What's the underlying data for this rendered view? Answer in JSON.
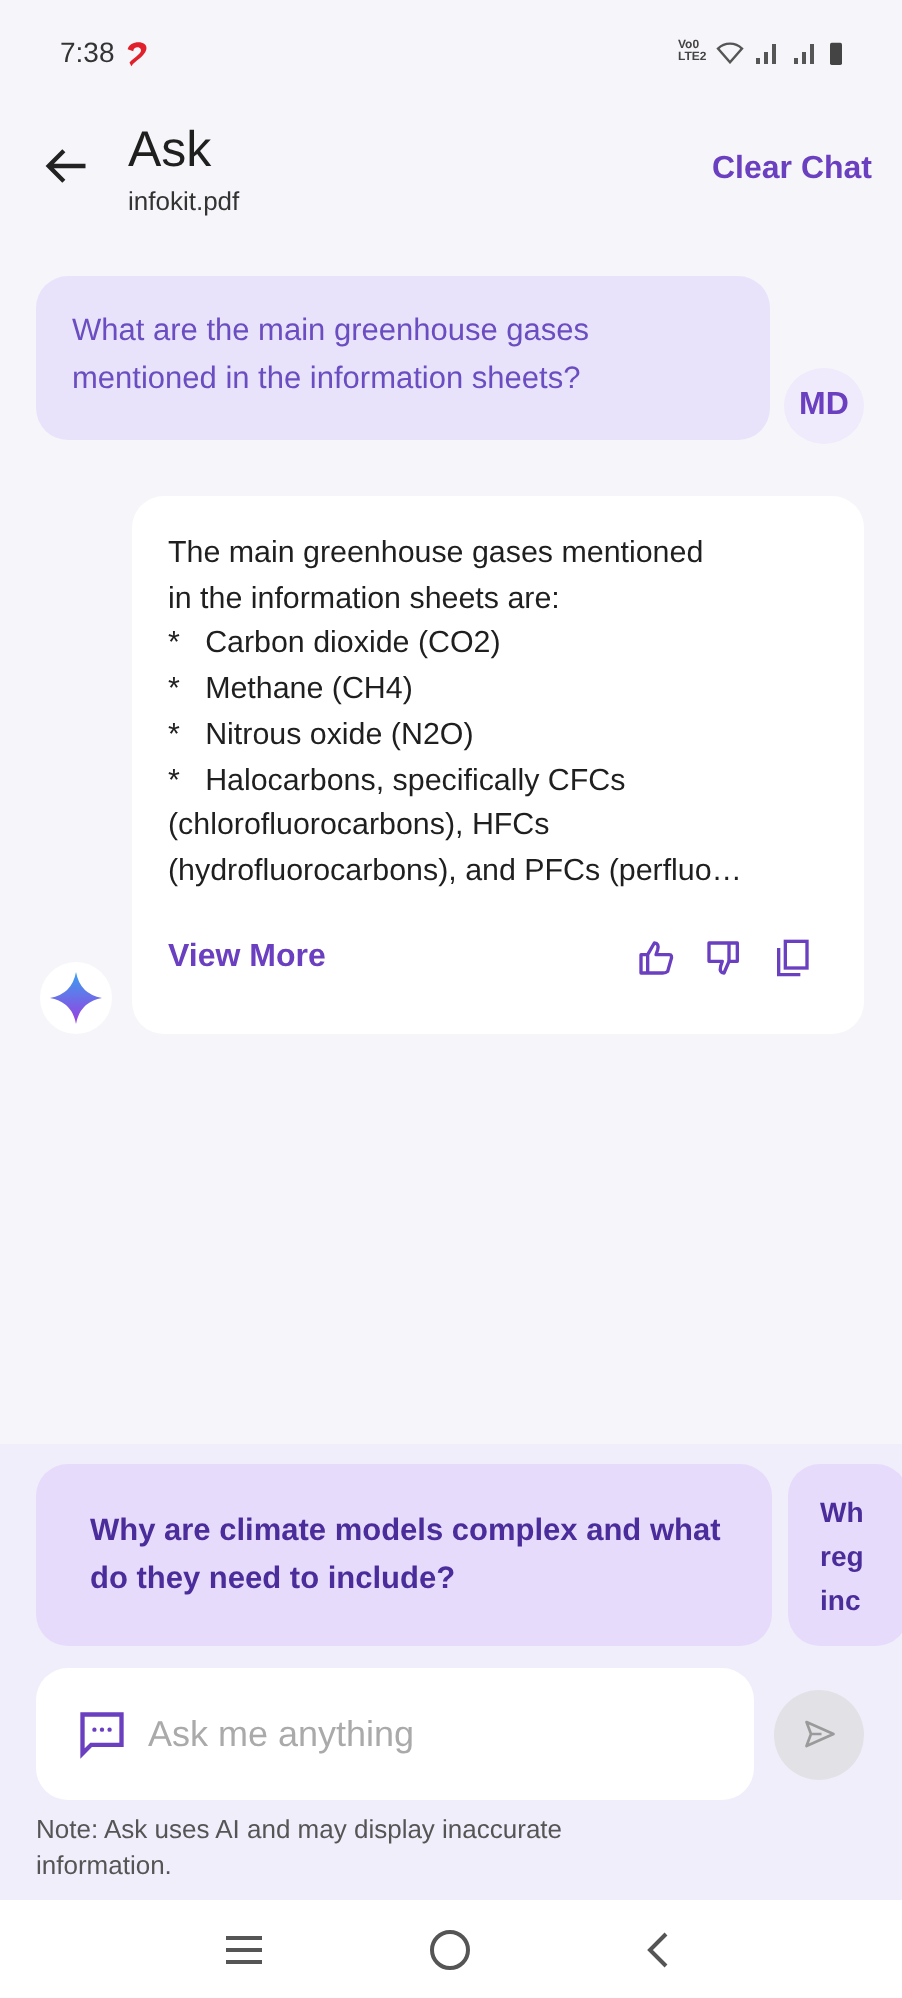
{
  "status_bar": {
    "time": "7:38",
    "network_label": "Vo0 LTE2"
  },
  "header": {
    "title": "Ask",
    "subtitle": "infokit.pdf",
    "action": "Clear Chat"
  },
  "messages": [
    {
      "kind": "user",
      "text": "What are the main greenhouse gases mentioned in the information sheets?",
      "avatar": "MD"
    },
    {
      "kind": "assistant",
      "text": "The main greenhouse gases mentioned\nin the information sheets are:\n*   Carbon dioxide (CO2)\n*   Methane (CH4)\n*   Nitrous oxide (N2O)\n*   Halocarbons, specifically CFCs\n(chlorofluorocarbons), HFCs\n(hydrofluorocarbons), and PFCs (perfluo…",
      "link": "View More"
    }
  ],
  "suggestions": [
    {
      "lines": [
        "Why are climate models complex and what",
        "do they need to include?"
      ]
    },
    {
      "lines": [
        "Wh",
        "reg",
        "inc"
      ]
    }
  ],
  "input": {
    "placeholder": "Ask me anything"
  },
  "note": "Note: Ask uses AI and may display inaccurate information."
}
